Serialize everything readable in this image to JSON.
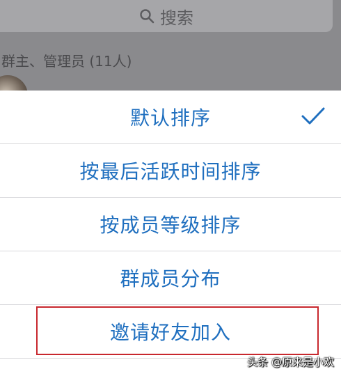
{
  "search": {
    "label": "搜索"
  },
  "members_header": "群主、管理员 (11人)",
  "sheet": {
    "items": [
      {
        "label": "默认排序",
        "selected": true
      },
      {
        "label": "按最后活跃时间排序"
      },
      {
        "label": "按成员等级排序"
      },
      {
        "label": "群成员分布"
      },
      {
        "label": "邀请好友加入",
        "highlighted": true
      }
    ]
  },
  "watermark": "头条 @原来是小欢",
  "colors": {
    "accent": "#1f6fbf",
    "highlight_border": "#c8282e"
  }
}
